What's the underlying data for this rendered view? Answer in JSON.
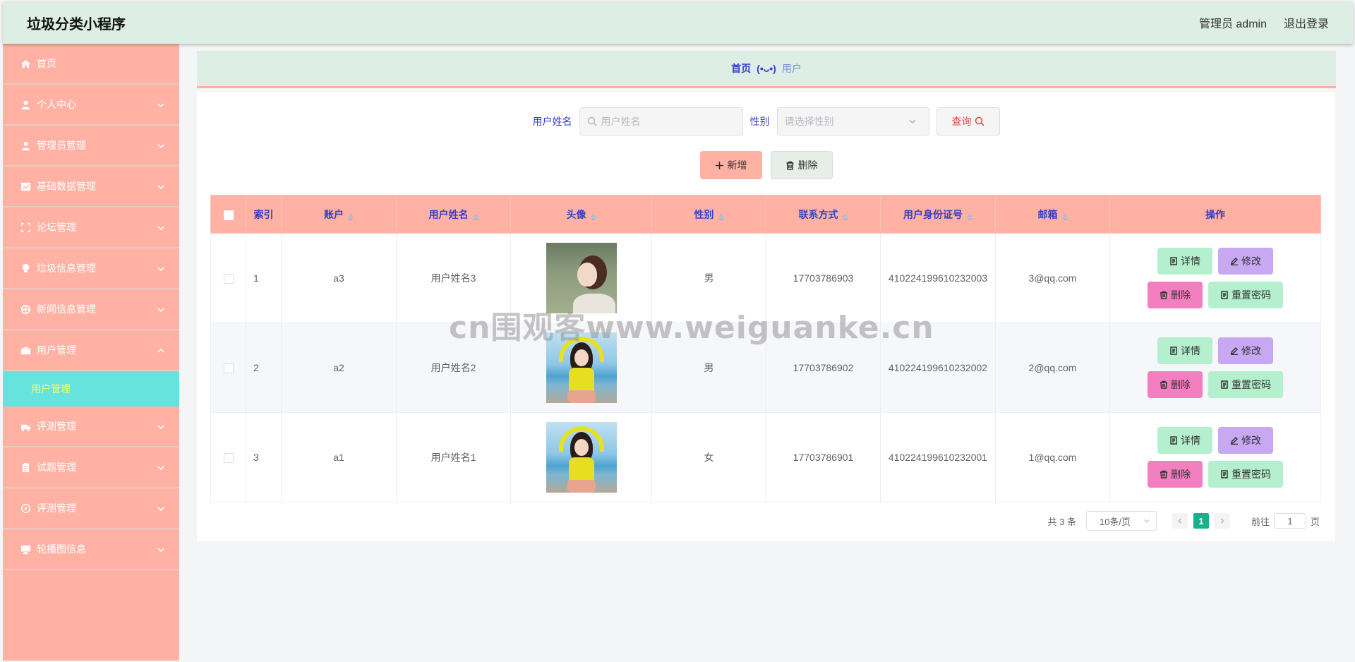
{
  "header": {
    "app_title": "垃圾分类小程序",
    "admin_label": "管理员 admin",
    "logout_label": "退出登录"
  },
  "sidebar": {
    "items": [
      {
        "label": "首页",
        "icon": "home-icon"
      },
      {
        "label": "个人中心",
        "icon": "user-icon"
      },
      {
        "label": "管理员管理",
        "icon": "user-icon"
      },
      {
        "label": "基础数据管理",
        "icon": "chart-icon"
      },
      {
        "label": "论坛管理",
        "icon": "frame-icon"
      },
      {
        "label": "垃圾信息管理",
        "icon": "bulb-icon"
      },
      {
        "label": "新闻信息管理",
        "icon": "globe-icon"
      },
      {
        "label": "用户管理",
        "icon": "briefcase-icon",
        "expanded": true
      },
      {
        "label": "评测管理",
        "icon": "truck-icon"
      },
      {
        "label": "试题管理",
        "icon": "clipboard-icon"
      },
      {
        "label": "评测管理",
        "icon": "compass-icon"
      },
      {
        "label": "轮播图信息",
        "icon": "monitor-icon"
      }
    ],
    "active_sub_item": "用户管理"
  },
  "breadcrumb": {
    "home": "首页",
    "separator": "(•ᴗ•)",
    "current": "用户"
  },
  "search": {
    "name_label": "用户姓名",
    "name_placeholder": "用户姓名",
    "sex_label": "性别",
    "sex_placeholder": "请选择性别",
    "query_label": "查询"
  },
  "actions": {
    "add_label": "新增",
    "delete_label": "删除"
  },
  "table": {
    "headers": [
      "索引",
      "账户",
      "用户姓名",
      "头像",
      "性别",
      "联系方式",
      "用户身份证号",
      "邮箱",
      "操作"
    ],
    "rows": [
      {
        "index": "1",
        "account": "a3",
        "name": "用户姓名3",
        "avatar": "profile-photo",
        "sex": "男",
        "phone": "17703786903",
        "id_no": "410224199610232003",
        "email": "3@qq.com"
      },
      {
        "index": "2",
        "account": "a2",
        "name": "用户姓名2",
        "avatar": "yellow-sweater-photo",
        "sex": "男",
        "phone": "17703786902",
        "id_no": "410224199610232002",
        "email": "2@qq.com"
      },
      {
        "index": "3",
        "account": "a1",
        "name": "用户姓名1",
        "avatar": "yellow-sweater-photo",
        "sex": "女",
        "phone": "17703786901",
        "id_no": "410224199610232001",
        "email": "1@qq.com"
      }
    ],
    "row_actions": {
      "detail": "详情",
      "edit": "修改",
      "remove": "删除",
      "reset": "重置密码"
    }
  },
  "pagination": {
    "total": "共 3 条",
    "page_size": "10条/页",
    "current_page": "1",
    "goto_prefix": "前往",
    "goto_value": "1",
    "goto_suffix": "页"
  },
  "watermark": "cn围观客www.weiguanke.cn",
  "colors": {
    "sidebar_bg": "#ffb2a4",
    "header_bg": "#ddeee4",
    "active_sub_bg": "#66e3dc",
    "accent_blue": "#3340c4",
    "page_active": "#16b28c"
  }
}
